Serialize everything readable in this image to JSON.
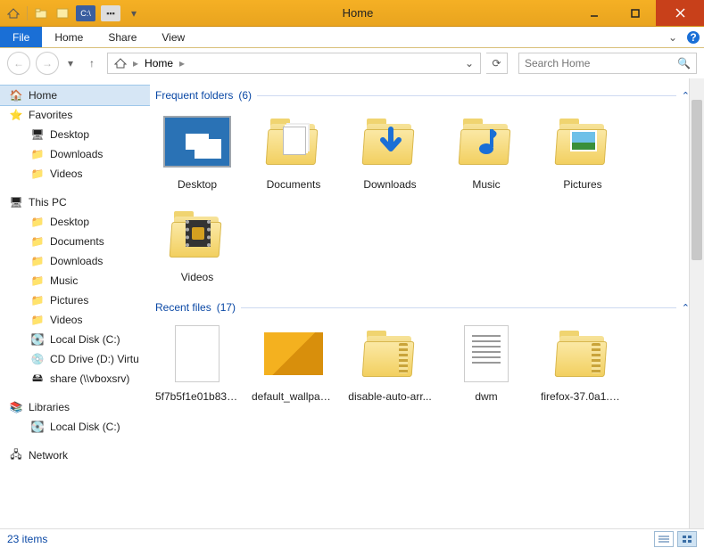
{
  "window": {
    "title": "Home"
  },
  "ribbon": {
    "file": "File",
    "tabs": [
      "Home",
      "Share",
      "View"
    ]
  },
  "nav": {
    "breadcrumb": [
      "Home"
    ],
    "search_placeholder": "Search Home"
  },
  "tree": {
    "home": "Home",
    "favorites": "Favorites",
    "fav_items": [
      "Desktop",
      "Downloads",
      "Videos"
    ],
    "thispc": "This PC",
    "pc_items": [
      "Desktop",
      "Documents",
      "Downloads",
      "Music",
      "Pictures",
      "Videos",
      "Local Disk (C:)",
      "CD Drive (D:) Virtu",
      "share (\\\\vboxsrv)"
    ],
    "libraries": "Libraries",
    "lib_items": [
      "Local Disk (C:)"
    ],
    "network": "Network"
  },
  "groups": {
    "frequent": {
      "title": "Frequent folders",
      "count": "(6)"
    },
    "recent": {
      "title": "Recent files",
      "count": "(17)"
    }
  },
  "frequent_items": [
    {
      "label": "Desktop",
      "kind": "desktop"
    },
    {
      "label": "Documents",
      "kind": "folder-doc"
    },
    {
      "label": "Downloads",
      "kind": "folder-down"
    },
    {
      "label": "Music",
      "kind": "folder-music"
    },
    {
      "label": "Pictures",
      "kind": "folder-pic"
    },
    {
      "label": "Videos",
      "kind": "folder-vid"
    }
  ],
  "recent_items": [
    {
      "label": "5f7b5f1e01b8376...",
      "kind": "blank"
    },
    {
      "label": "default_wallpape...",
      "kind": "image"
    },
    {
      "label": "disable-auto-arr...",
      "kind": "zip"
    },
    {
      "label": "dwm",
      "kind": "textdoc"
    },
    {
      "label": "firefox-37.0a1.en...",
      "kind": "zip"
    }
  ],
  "status": {
    "text": "23 items"
  }
}
